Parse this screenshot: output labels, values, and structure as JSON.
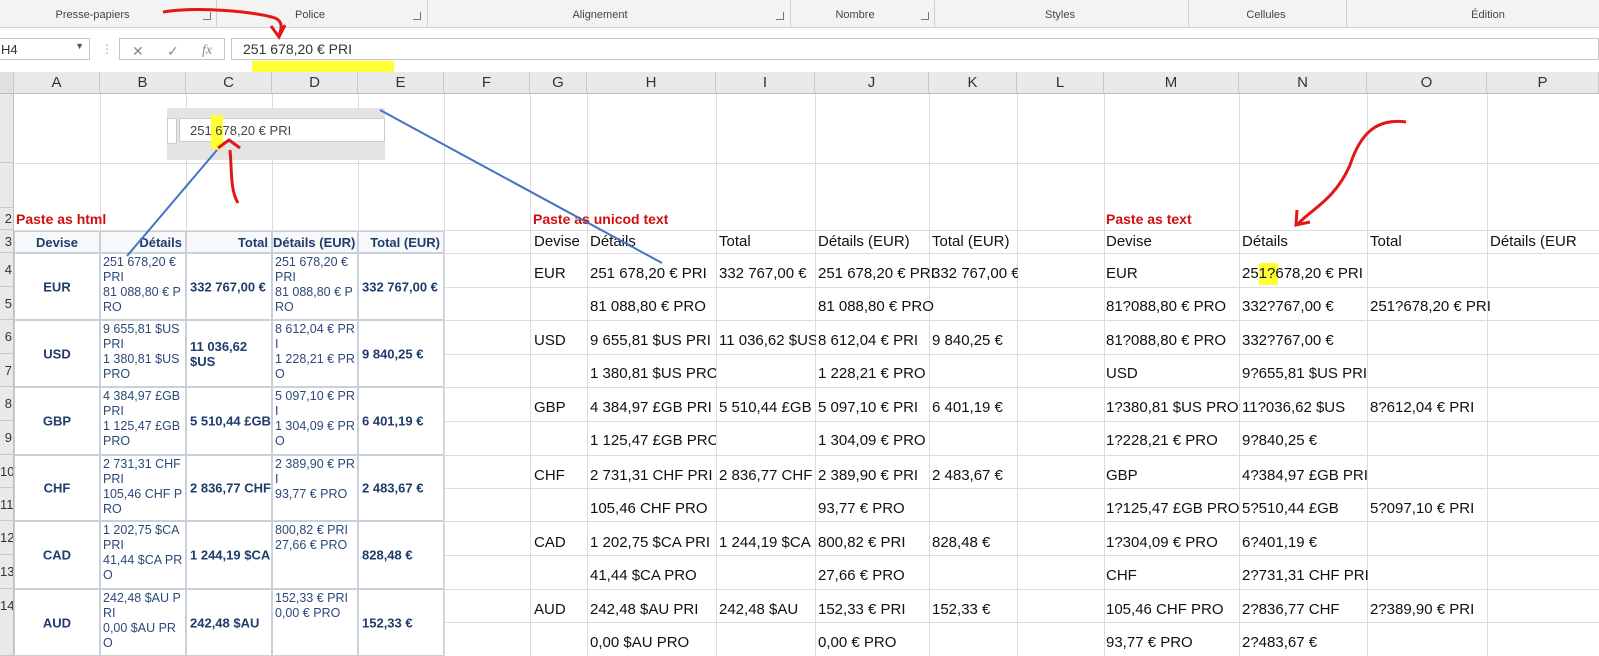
{
  "ribbon": {
    "groups": [
      "Presse-papiers",
      "Police",
      "Alignement",
      "Nombre",
      "Styles",
      "Cellules",
      "Édition"
    ]
  },
  "formula_bar": {
    "name_box": "H4",
    "cancel_icon": "✕",
    "enter_icon": "✓",
    "fx_label": "fx",
    "formula": "251 678,20 € PRI"
  },
  "inset_formula": "251 678,20 € PRI",
  "columns": [
    "A",
    "B",
    "C",
    "D",
    "E",
    "F",
    "G",
    "H",
    "I",
    "J",
    "K",
    "L",
    "M",
    "N",
    "O",
    "P"
  ],
  "rows": [
    "2",
    "3",
    "4",
    "5",
    "6",
    "7",
    "8",
    "9",
    "10",
    "11",
    "12",
    "13",
    "14"
  ],
  "html_section": {
    "title": "Paste as html",
    "headers": [
      "Devise",
      "Détails",
      "Total",
      "Détails (EUR)",
      "Total (EUR)"
    ],
    "rows": [
      {
        "devise": "EUR",
        "details": "251 678,20 € PRI\n81 088,80 € PRO",
        "total": "332 767,00 €",
        "details_eur": "251 678,20 € PRI\n81 088,80 € PRO",
        "total_eur": "332 767,00 €"
      },
      {
        "devise": "USD",
        "details": "9 655,81 $US PRI\n1 380,81 $US PRO",
        "total": "11 036,62 $US",
        "details_eur": "8 612,04 € PRI\n1 228,21 € PRO",
        "total_eur": "9 840,25 €"
      },
      {
        "devise": "GBP",
        "details": "4 384,97 £GB PRI\n1 125,47 £GB PRO",
        "total": "5 510,44 £GB",
        "details_eur": "5 097,10 € PRI\n1 304,09 € PRO",
        "total_eur": "6 401,19 €"
      },
      {
        "devise": "CHF",
        "details": "2 731,31 CHF PRI\n105,46 CHF PRO",
        "total": "2 836,77 CHF",
        "details_eur": "2 389,90 € PRI\n93,77 € PRO",
        "total_eur": "2 483,67 €"
      },
      {
        "devise": "CAD",
        "details": "1 202,75 $CA PRI\n41,44 $CA PRO",
        "total": "1 244,19 $CA",
        "details_eur": "800,82 € PRI\n27,66 € PRO",
        "total_eur": "828,48 €"
      },
      {
        "devise": "AUD",
        "details": "242,48 $AU PRI\n0,00 $AU PRO",
        "total": "242,48 $AU",
        "details_eur": "152,33 € PRI\n0,00 € PRO",
        "total_eur": "152,33 €"
      }
    ]
  },
  "unicode_section": {
    "title": "Paste as unicod text",
    "headers": [
      "Devise",
      "Détails",
      "Total",
      "Détails (EUR)",
      "Total (EUR)"
    ],
    "lines": [
      [
        "EUR",
        "251 678,20 € PRI",
        "332 767,00 €",
        "251 678,20 € PRI",
        "332 767,00 €"
      ],
      [
        "",
        "81 088,80 € PRO",
        "",
        "81 088,80 € PRO",
        ""
      ],
      [
        "USD",
        "9 655,81 $US PRI",
        "11 036,62 $US",
        "8 612,04 € PRI",
        "9 840,25 €"
      ],
      [
        "",
        "1 380,81 $US PRO",
        "",
        "1 228,21 € PRO",
        ""
      ],
      [
        "GBP",
        "4 384,97 £GB PRI",
        "5 510,44 £GB",
        "5 097,10 € PRI",
        "6 401,19 €"
      ],
      [
        "",
        "1 125,47 £GB PRO",
        "",
        "1 304,09 € PRO",
        ""
      ],
      [
        "CHF",
        "2 731,31 CHF PRI",
        "2 836,77 CHF",
        "2 389,90 € PRI",
        "2 483,67 €"
      ],
      [
        "",
        "105,46 CHF PRO",
        "",
        "93,77 € PRO",
        ""
      ],
      [
        "CAD",
        "1 202,75 $CA PRI",
        "1 244,19 $CA",
        "800,82 € PRI",
        "828,48 €"
      ],
      [
        "",
        "41,44 $CA PRO",
        "",
        "27,66 € PRO",
        ""
      ],
      [
        "AUD",
        "242,48 $AU PRI",
        "242,48 $AU",
        "152,33 € PRI",
        "152,33 €"
      ],
      [
        "",
        "0,00 $AU PRO",
        "",
        "0,00 € PRO",
        ""
      ]
    ]
  },
  "text_section": {
    "title": "Paste as text",
    "headers": [
      "Devise",
      "Détails",
      "Total",
      "Détails (EUR"
    ],
    "lines": [
      [
        "EUR",
        "251?678,20 € PRI",
        ""
      ],
      [
        "81?088,80 € PRO",
        "332?767,00 €",
        "251?678,20 € PRI"
      ],
      [
        "81?088,80 € PRO",
        "332?767,00 €",
        ""
      ],
      [
        "USD",
        "9?655,81 $US PRI",
        ""
      ],
      [
        "1?380,81 $US PRO",
        "11?036,62 $US",
        "8?612,04 € PRI"
      ],
      [
        "1?228,21 € PRO",
        "9?840,25 €",
        ""
      ],
      [
        "GBP",
        "4?384,97 £GB PRI",
        ""
      ],
      [
        "1?125,47 £GB PRO",
        "5?510,44 £GB",
        "5?097,10 € PRI"
      ],
      [
        "1?304,09 € PRO",
        "6?401,19 €",
        ""
      ],
      [
        "CHF",
        "2?731,31 CHF PRI",
        ""
      ],
      [
        "105,46 CHF PRO",
        "2?836,77 CHF",
        "2?389,90 € PRI"
      ],
      [
        "93,77 € PRO",
        "2?483,67 €",
        ""
      ]
    ]
  },
  "colors": {
    "annotation_red": "#e01818",
    "highlight": "#ffff33",
    "arrow_blue": "#4472c4"
  }
}
